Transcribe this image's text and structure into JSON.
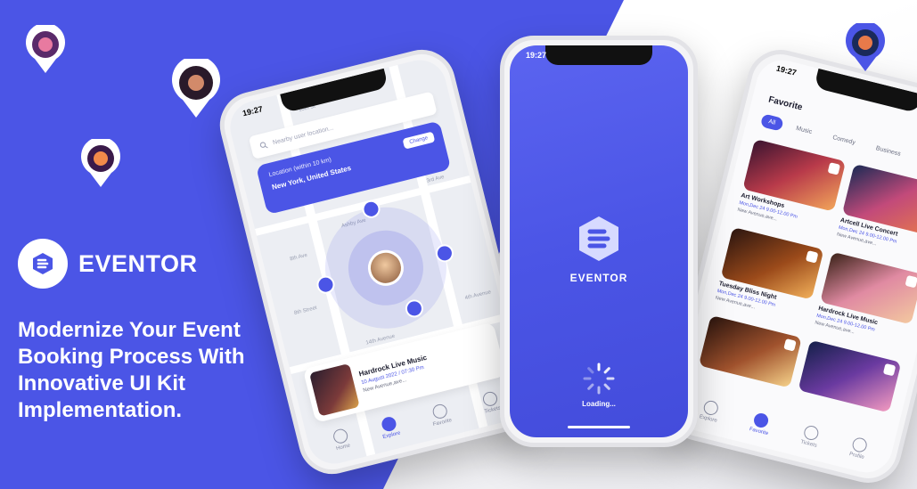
{
  "brand": {
    "name": "EVENTOR",
    "headline": [
      "Modernize Your Event",
      "Booking Process With",
      "Innovative UI Kit",
      "Implementation."
    ],
    "accent": "#4b55e6"
  },
  "pins": [
    "map-pin-icon",
    "map-pin-icon",
    "map-pin-icon",
    "map-pin-icon"
  ],
  "left_phone": {
    "time": "19:27",
    "search_placeholder": "Nearby user location...",
    "location_sub": "Location (within 10 km)",
    "location_main": "New York, United States",
    "change_label": "Change",
    "streets": [
      "10th St",
      "3rd Ave",
      "14th Avenue",
      "4th Avenue",
      "8th Ave",
      "Ashby Ave",
      "8th Street"
    ],
    "event": {
      "tag": "Nearby",
      "title": "Hardrock Live Music",
      "date": "10 August 2022 / 07:30 Pm",
      "place": "New Avenue,ave..."
    },
    "tabs": [
      "Home",
      "Explore",
      "Favorite",
      "Tickets"
    ]
  },
  "center_phone": {
    "time": "19:27",
    "title": "EVENTOR",
    "loading": "Loading..."
  },
  "right_phone": {
    "time": "19:27",
    "title": "Favorite",
    "chips": [
      "All",
      "Music",
      "Comedy",
      "Business"
    ],
    "events": [
      {
        "name": "Art Workshops",
        "date": "Mon,Dec 24  9.00-12.00 Pm",
        "place": "New Avenue,ave..."
      },
      {
        "name": "Artcell Live Concert",
        "date": "Mon,Dec 24  9.00-12.00 Pm",
        "place": "New Avenue,ave..."
      },
      {
        "name": "Tuesday Bliss Night",
        "date": "Mon,Dec 24  9.00-12.00 Pm",
        "place": "New Avenue,ave..."
      },
      {
        "name": "Hardrock Live Music",
        "date": "Mon,Dec 24  9.00-12.00 Pm",
        "place": "New Avenue,ave..."
      },
      {
        "name": "",
        "date": "",
        "place": ""
      },
      {
        "name": "",
        "date": "",
        "place": ""
      }
    ],
    "tabs": [
      "Explore",
      "Favorite",
      "Tickets",
      "Profile"
    ]
  }
}
